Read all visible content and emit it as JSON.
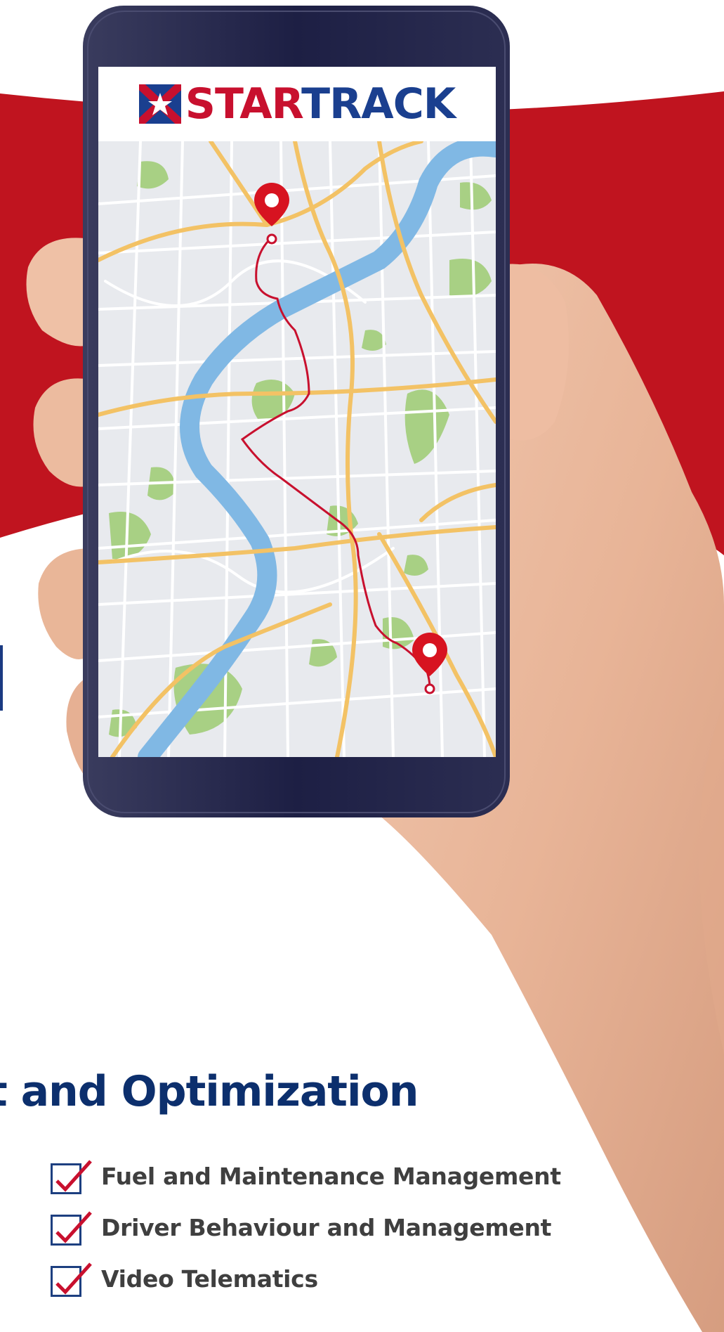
{
  "brand": {
    "word_part1": "STAR",
    "word_part2": "TRACK",
    "red": "#c8102e",
    "navy": "#1a3f8f"
  },
  "icons": [
    "check-icon",
    "map-pin-icon",
    "logo-flag-icon"
  ],
  "heading": "t and Optimization",
  "features": [
    {
      "label": "Fuel and Maintenance Management"
    },
    {
      "label": "Driver Behaviour and Management"
    },
    {
      "label": "Video Telematics"
    }
  ],
  "colors": {
    "banner_red": "#c0141f",
    "heading_blue": "#0c2f6d",
    "phone_frame": "#1d1f44",
    "map_bg": "#e8eaee",
    "map_river": "#80b8e4",
    "map_road": "#f3c265",
    "map_park": "#a8d084",
    "route": "#c8102e"
  }
}
